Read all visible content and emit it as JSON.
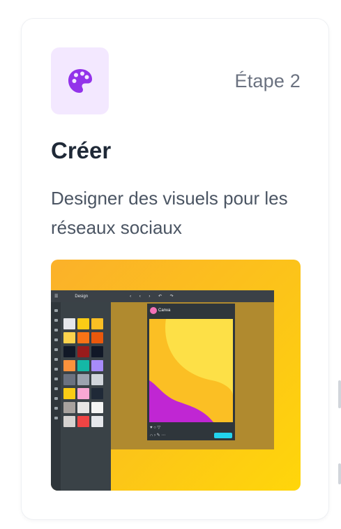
{
  "step_label": "Étape 2",
  "title": "Créer",
  "description": "Designer des visuels pour les réseaux sociaux",
  "icon": "palette-icon",
  "colors": {
    "accent": "#9333ea",
    "icon_bg": "#f3e8ff",
    "title": "#1f2937",
    "muted": "#6b7280"
  },
  "preview": {
    "image": "design-editor-screenshot",
    "panel_title": "Design",
    "post_user": "Canva"
  }
}
